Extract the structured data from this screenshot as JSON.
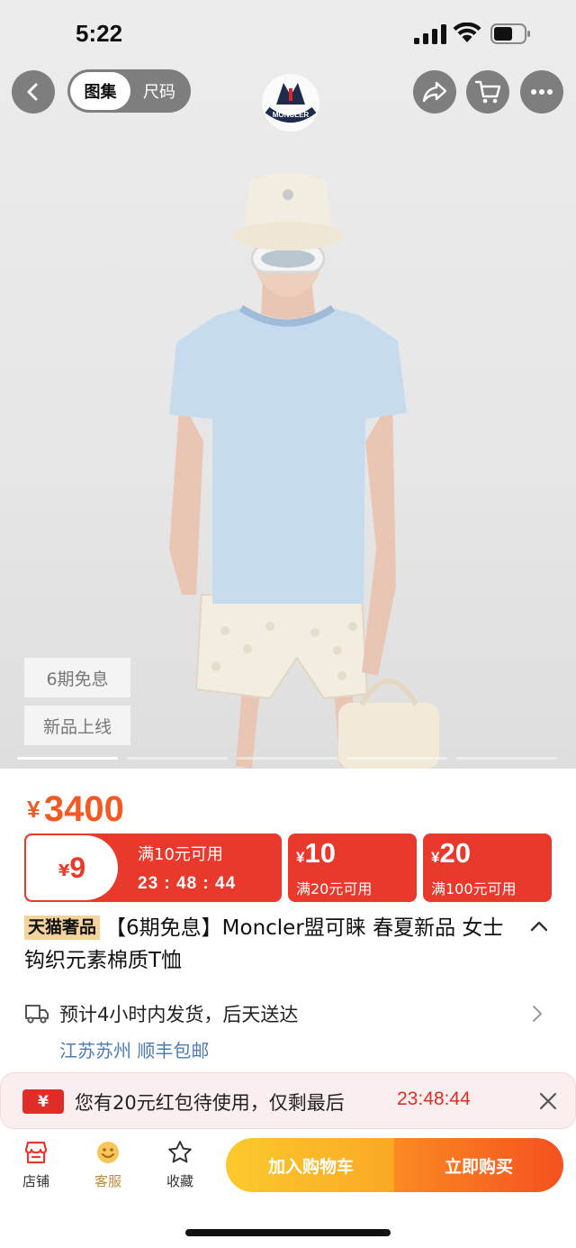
{
  "status_bar": {
    "time": "5:22"
  },
  "header": {
    "tabs": [
      {
        "label": "图集",
        "active": true
      },
      {
        "label": "尺码",
        "active": false
      }
    ],
    "brand": "MONCLER"
  },
  "hero": {
    "tags": [
      "6期免息",
      "新品上线"
    ],
    "pager": {
      "count": 5,
      "active_index": 0
    }
  },
  "price": {
    "currency": "¥",
    "amount": "3400"
  },
  "coupons": [
    {
      "currency": "¥",
      "value": "9",
      "condition": "满10元可用",
      "timer": "23 : 48 : 44"
    },
    {
      "currency": "¥",
      "value": "10",
      "condition": "满20元可用"
    },
    {
      "currency": "¥",
      "value": "20",
      "condition": "满100元可用"
    }
  ],
  "title": {
    "badge": "天猫奢品",
    "text": "【6期免息】Moncler盟可睐 春夏新品 女士钩织元素棉质T恤"
  },
  "delivery": {
    "text": "预计4小时内发货，后天送达",
    "location": "江苏苏州  顺丰包邮"
  },
  "red_packet": {
    "icon": "¥",
    "text": "您有20元红包待使用，仅剩最后",
    "timer": "23:48:44"
  },
  "bottom_nav": {
    "items": [
      {
        "label": "店铺",
        "icon": "shop-icon"
      },
      {
        "label": "客服",
        "icon": "customer-service-icon"
      },
      {
        "label": "收藏",
        "icon": "star-icon"
      }
    ],
    "add_to_cart": "加入购物车",
    "buy_now": "立即购买"
  },
  "colors": {
    "accent_red": "#e8392c",
    "price_orange": "#f15a22",
    "cart_yellow": "#f9a825",
    "buy_orange": "#f4511e",
    "location_blue": "#4e7bb3",
    "badge_gold": "#f3d49b"
  }
}
